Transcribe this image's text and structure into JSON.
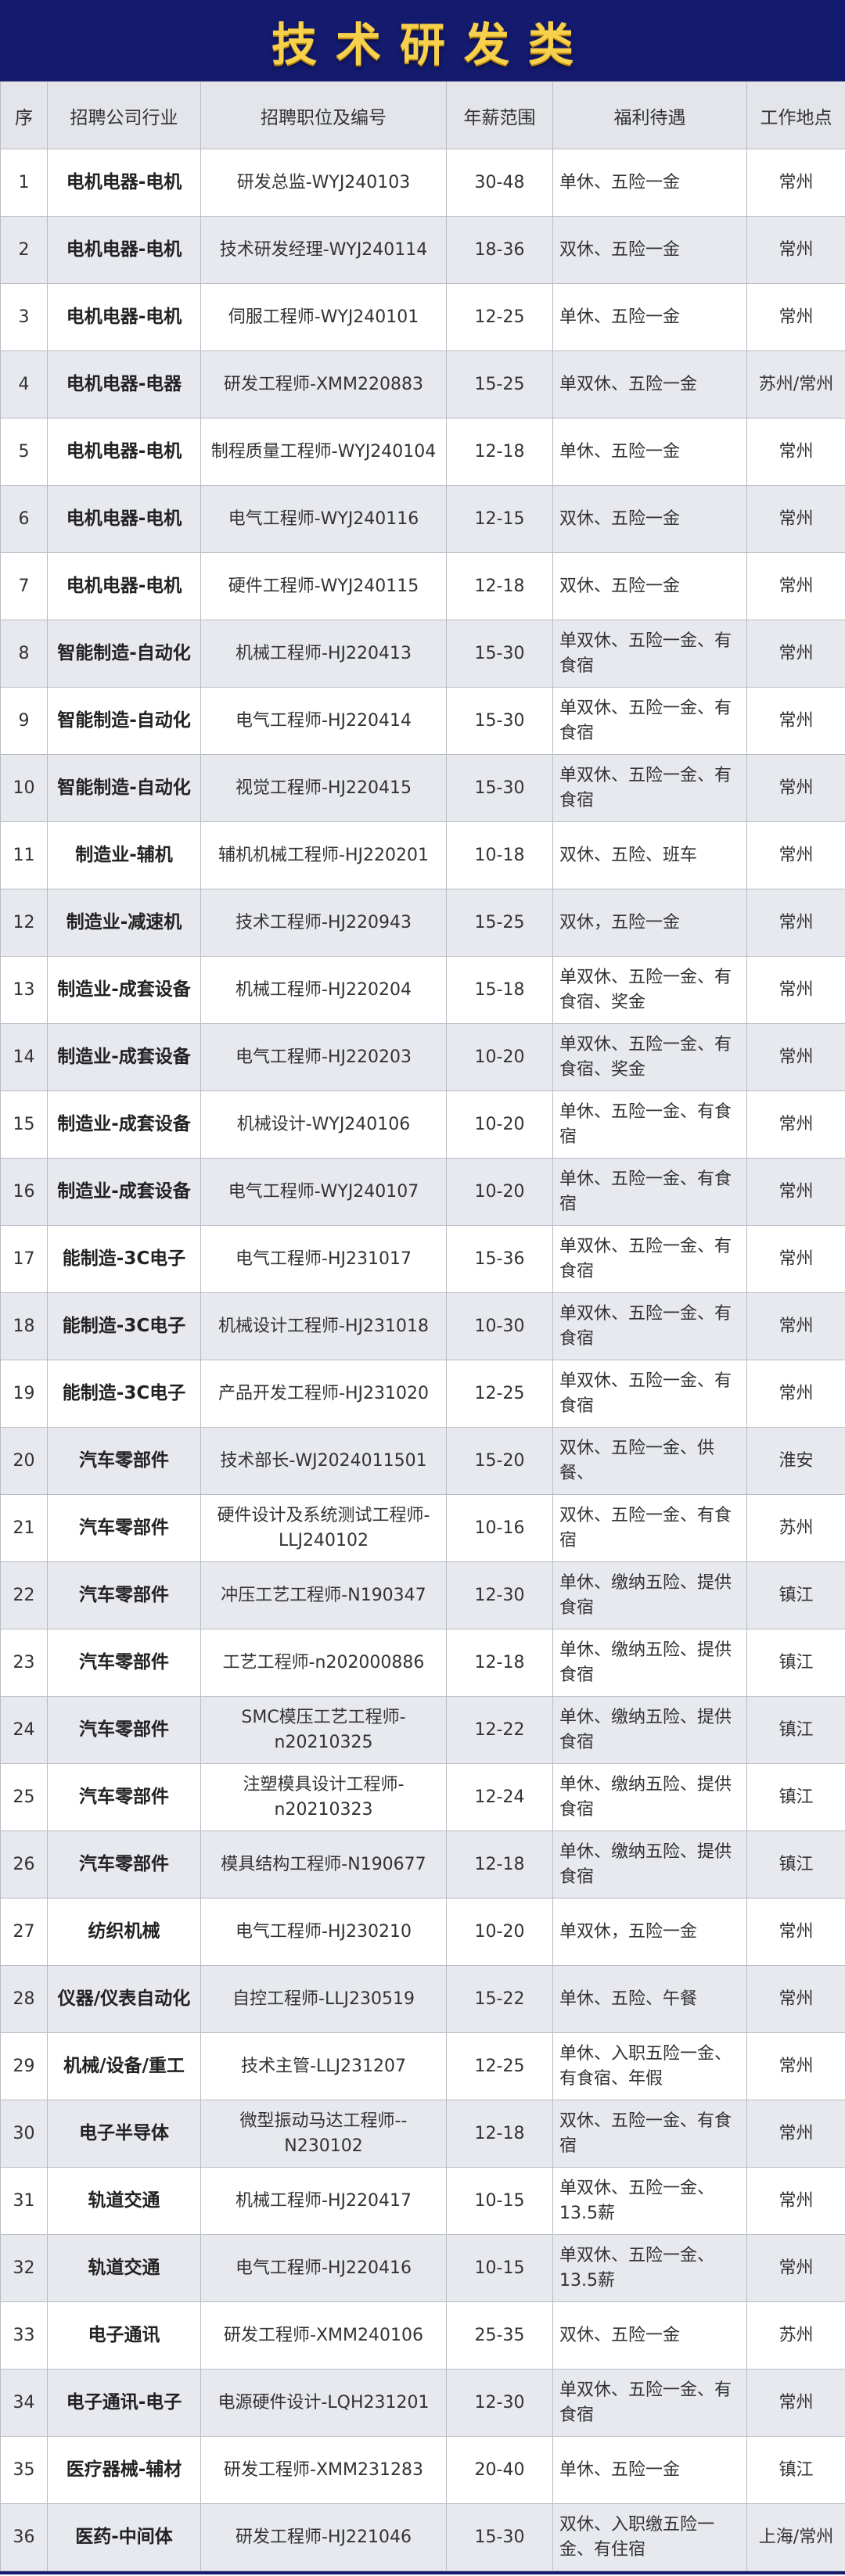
{
  "header": {
    "title": "技术研发类"
  },
  "columns": [
    "序",
    "招聘公司行业",
    "招聘职位及编号",
    "年薪范围",
    "福利待遇",
    "工作地点"
  ],
  "rows": [
    {
      "seq": "1",
      "industry": "电机电器-电机",
      "position": "研发总监-WYJ240103",
      "salary": "30-48",
      "benefit": "单休、五险一金",
      "location": "常州"
    },
    {
      "seq": "2",
      "industry": "电机电器-电机",
      "position": "技术研发经理-WYJ240114",
      "salary": "18-36",
      "benefit": "双休、五险一金",
      "location": "常州"
    },
    {
      "seq": "3",
      "industry": "电机电器-电机",
      "position": "伺服工程师-WYJ240101",
      "salary": "12-25",
      "benefit": "单休、五险一金",
      "location": "常州"
    },
    {
      "seq": "4",
      "industry": "电机电器-电器",
      "position": "研发工程师-XMM220883",
      "salary": "15-25",
      "benefit": "单双休、五险一金",
      "location": "苏州/常州"
    },
    {
      "seq": "5",
      "industry": "电机电器-电机",
      "position": "制程质量工程师-WYJ240104",
      "salary": "12-18",
      "benefit": "单休、五险一金",
      "location": "常州"
    },
    {
      "seq": "6",
      "industry": "电机电器-电机",
      "position": "电气工程师-WYJ240116",
      "salary": "12-15",
      "benefit": "双休、五险一金",
      "location": "常州"
    },
    {
      "seq": "7",
      "industry": "电机电器-电机",
      "position": "硬件工程师-WYJ240115",
      "salary": "12-18",
      "benefit": "双休、五险一金",
      "location": "常州"
    },
    {
      "seq": "8",
      "industry": "智能制造-自动化",
      "position": "机械工程师-HJ220413",
      "salary": "15-30",
      "benefit": "单双休、五险一金、有食宿",
      "location": "常州"
    },
    {
      "seq": "9",
      "industry": "智能制造-自动化",
      "position": "电气工程师-HJ220414",
      "salary": "15-30",
      "benefit": "单双休、五险一金、有食宿",
      "location": "常州"
    },
    {
      "seq": "10",
      "industry": "智能制造-自动化",
      "position": "视觉工程师-HJ220415",
      "salary": "15-30",
      "benefit": "单双休、五险一金、有食宿",
      "location": "常州"
    },
    {
      "seq": "11",
      "industry": "制造业-辅机",
      "position": "辅机机械工程师-HJ220201",
      "salary": "10-18",
      "benefit": "双休、五险、班车",
      "location": "常州"
    },
    {
      "seq": "12",
      "industry": "制造业-减速机",
      "position": "技术工程师-HJ220943",
      "salary": "15-25",
      "benefit": "双休，五险一金",
      "location": "常州"
    },
    {
      "seq": "13",
      "industry": "制造业-成套设备",
      "position": "机械工程师-HJ220204",
      "salary": "15-18",
      "benefit": "单双休、五险一金、有食宿、奖金",
      "location": "常州"
    },
    {
      "seq": "14",
      "industry": "制造业-成套设备",
      "position": "电气工程师-HJ220203",
      "salary": "10-20",
      "benefit": "单双休、五险一金、有食宿、奖金",
      "location": "常州"
    },
    {
      "seq": "15",
      "industry": "制造业-成套设备",
      "position": "机械设计-WYJ240106",
      "salary": "10-20",
      "benefit": "单休、五险一金、有食宿",
      "location": "常州"
    },
    {
      "seq": "16",
      "industry": "制造业-成套设备",
      "position": "电气工程师-WYJ240107",
      "salary": "10-20",
      "benefit": "单休、五险一金、有食宿",
      "location": "常州"
    },
    {
      "seq": "17",
      "industry": "能制造-3C电子",
      "position": "电气工程师-HJ231017",
      "salary": "15-36",
      "benefit": "单双休、五险一金、有食宿",
      "location": "常州"
    },
    {
      "seq": "18",
      "industry": "能制造-3C电子",
      "position": "机械设计工程师-HJ231018",
      "salary": "10-30",
      "benefit": "单双休、五险一金、有食宿",
      "location": "常州"
    },
    {
      "seq": "19",
      "industry": "能制造-3C电子",
      "position": "产品开发工程师-HJ231020",
      "salary": "12-25",
      "benefit": "单双休、五险一金、有食宿",
      "location": "常州"
    },
    {
      "seq": "20",
      "industry": "汽车零部件",
      "position": "技术部长-WJ2024011501",
      "salary": "15-20",
      "benefit": "双休、五险一金、供餐、",
      "location": "淮安"
    },
    {
      "seq": "21",
      "industry": "汽车零部件",
      "position": "硬件设计及系统测试工程师-LLJ240102",
      "salary": "10-16",
      "benefit": "双休、五险一金、有食宿",
      "location": "苏州"
    },
    {
      "seq": "22",
      "industry": "汽车零部件",
      "position": "冲压工艺工程师-N190347",
      "salary": "12-30",
      "benefit": "单休、缴纳五险、提供食宿",
      "location": "镇江"
    },
    {
      "seq": "23",
      "industry": "汽车零部件",
      "position": "工艺工程师-n202000886",
      "salary": "12-18",
      "benefit": "单休、缴纳五险、提供食宿",
      "location": "镇江"
    },
    {
      "seq": "24",
      "industry": "汽车零部件",
      "position": "SMC模压工艺工程师-n20210325",
      "salary": "12-22",
      "benefit": "单休、缴纳五险、提供食宿",
      "location": "镇江"
    },
    {
      "seq": "25",
      "industry": "汽车零部件",
      "position": "注塑模具设计工程师-n20210323",
      "salary": "12-24",
      "benefit": "单休、缴纳五险、提供食宿",
      "location": "镇江"
    },
    {
      "seq": "26",
      "industry": "汽车零部件",
      "position": "模具结构工程师-N190677",
      "salary": "12-18",
      "benefit": "单休、缴纳五险、提供食宿",
      "location": "镇江"
    },
    {
      "seq": "27",
      "industry": "纺织机械",
      "position": "电气工程师-HJ230210",
      "salary": "10-20",
      "benefit": "单双休，五险一金",
      "location": "常州"
    },
    {
      "seq": "28",
      "industry": "仪器/仪表自动化",
      "position": "自控工程师-LLJ230519",
      "salary": "15-22",
      "benefit": "单休、五险、午餐",
      "location": "常州"
    },
    {
      "seq": "29",
      "industry": "机械/设备/重工",
      "position": "技术主管-LLJ231207",
      "salary": "12-25",
      "benefit": "单休、入职五险一金、有食宿、年假",
      "location": "常州"
    },
    {
      "seq": "30",
      "industry": "电子半导体",
      "position": "微型振动马达工程师--N230102",
      "salary": "12-18",
      "benefit": "双休、五险一金、有食宿",
      "location": "常州"
    },
    {
      "seq": "31",
      "industry": "轨道交通",
      "position": "机械工程师-HJ220417",
      "salary": "10-15",
      "benefit": "单双休、五险一金、13.5薪",
      "location": "常州"
    },
    {
      "seq": "32",
      "industry": "轨道交通",
      "position": "电气工程师-HJ220416",
      "salary": "10-15",
      "benefit": "单双休、五险一金、13.5薪",
      "location": "常州"
    },
    {
      "seq": "33",
      "industry": "电子通讯",
      "position": "研发工程师-XMM240106",
      "salary": "25-35",
      "benefit": "双休、五险一金",
      "location": "苏州"
    },
    {
      "seq": "34",
      "industry": "电子通讯-电子",
      "position": "电源硬件设计-LQH231201",
      "salary": "12-30",
      "benefit": "单双休、五险一金、有食宿",
      "location": "常州"
    },
    {
      "seq": "35",
      "industry": "医疗器械-辅材",
      "position": "研发工程师-XMM231283",
      "salary": "20-40",
      "benefit": "单休、五险一金",
      "location": "镇江"
    },
    {
      "seq": "36",
      "industry": "医药-中间体",
      "position": "研发工程师-HJ221046",
      "salary": "15-30",
      "benefit": "双休、入职缴五险一金、有住宿",
      "location": "上海/常州"
    }
  ]
}
